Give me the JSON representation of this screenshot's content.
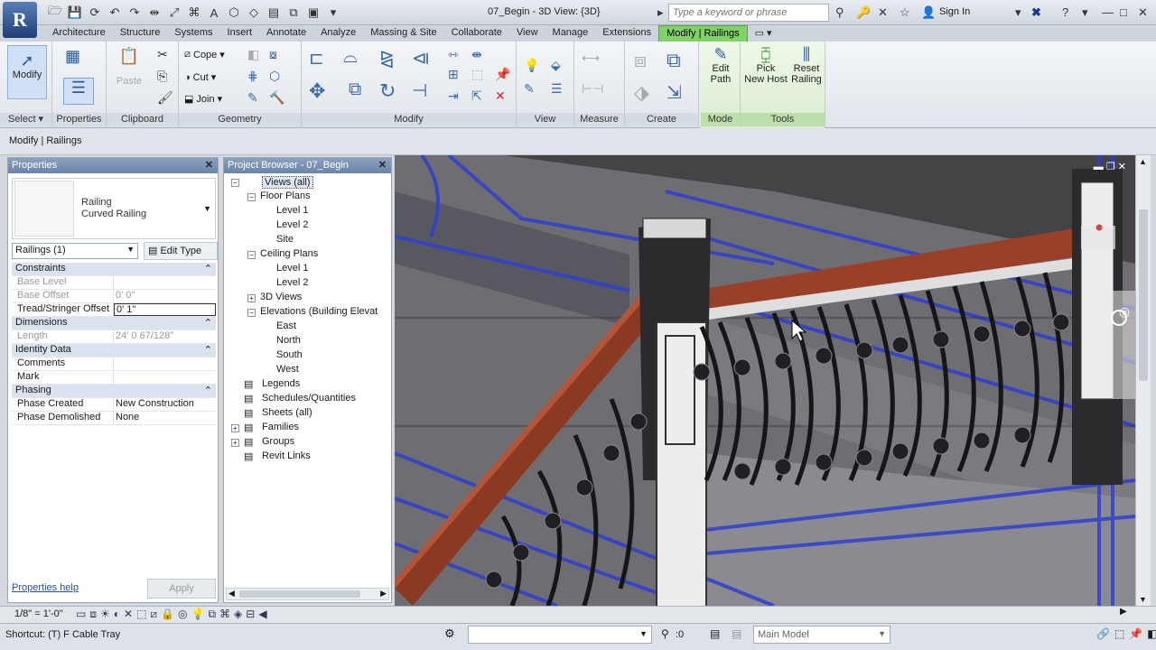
{
  "app": {
    "logo": "R",
    "title": "07_Begin - 3D View: {3D}"
  },
  "search": {
    "placeholder": "Type a keyword or phrase"
  },
  "user": {
    "signin": "Sign In"
  },
  "tabs": [
    "Architecture",
    "Structure",
    "Systems",
    "Insert",
    "Annotate",
    "Analyze",
    "Massing & Site",
    "Collaborate",
    "View",
    "Manage",
    "Extensions",
    "Modify | Railings"
  ],
  "ribbon": {
    "select": {
      "label": "Select",
      "modify": "Modify"
    },
    "properties": {
      "label": "Properties"
    },
    "clipboard": {
      "label": "Clipboard",
      "paste": "Paste"
    },
    "geometry": {
      "label": "Geometry",
      "cope": "Cope",
      "cut": "Cut",
      "join": "Join"
    },
    "modify": {
      "label": "Modify"
    },
    "view": {
      "label": "View"
    },
    "measure": {
      "label": "Measure"
    },
    "create": {
      "label": "Create"
    },
    "mode": {
      "label": "Mode",
      "edit_path": "Edit Path",
      "edit_path_l1": "Edit",
      "edit_path_l2": "Path"
    },
    "tools": {
      "label": "Tools",
      "pick_l1": "Pick",
      "pick_l2": "New Host",
      "reset_l1": "Reset",
      "reset_l2": "Railing"
    }
  },
  "context_bar": {
    "label": "Modify | Railings"
  },
  "properties": {
    "title": "Properties",
    "type_line1": "Railing",
    "type_line2": "Curved Railing",
    "instance_filter": "Railings (1)",
    "edit_type": "Edit Type",
    "rows": [
      {
        "cat": "Constraints"
      },
      {
        "k": "Base Level",
        "v": "",
        "dis": true
      },
      {
        "k": "Base Offset",
        "v": "0'  0\"",
        "dis": true
      },
      {
        "k": "Tread/Stringer Offset",
        "v": "0'  1\"",
        "edit": true
      },
      {
        "cat": "Dimensions"
      },
      {
        "k": "Length",
        "v": "24'  0 67/128\"",
        "dis": true
      },
      {
        "cat": "Identity Data"
      },
      {
        "k": "Comments",
        "v": ""
      },
      {
        "k": "Mark",
        "v": ""
      },
      {
        "cat": "Phasing"
      },
      {
        "k": "Phase Created",
        "v": "New Construction"
      },
      {
        "k": "Phase Demolished",
        "v": "None"
      }
    ],
    "help": "Properties help",
    "apply": "Apply"
  },
  "browser": {
    "title": "Project Browser - 07_Begin",
    "nodes": [
      {
        "t": "Views (all)",
        "lvl": 0,
        "tog": "−",
        "sel": true
      },
      {
        "t": "Floor Plans",
        "lvl": 1,
        "tog": "−"
      },
      {
        "t": "Level 1",
        "lvl": 2
      },
      {
        "t": "Level 2",
        "lvl": 2
      },
      {
        "t": "Site",
        "lvl": 2
      },
      {
        "t": "Ceiling Plans",
        "lvl": 1,
        "tog": "−"
      },
      {
        "t": "Level 1",
        "lvl": 2
      },
      {
        "t": "Level 2",
        "lvl": 2
      },
      {
        "t": "3D Views",
        "lvl": 1,
        "tog": "+"
      },
      {
        "t": "Elevations (Building Elevat",
        "lvl": 1,
        "tog": "−"
      },
      {
        "t": "East",
        "lvl": 2
      },
      {
        "t": "North",
        "lvl": 2
      },
      {
        "t": "South",
        "lvl": 2
      },
      {
        "t": "West",
        "lvl": 2
      },
      {
        "t": "Legends",
        "lvl": 0
      },
      {
        "t": "Schedules/Quantities",
        "lvl": 0
      },
      {
        "t": "Sheets (all)",
        "lvl": 0
      },
      {
        "t": "Families",
        "lvl": 0,
        "tog": "+"
      },
      {
        "t": "Groups",
        "lvl": 0,
        "tog": "+"
      },
      {
        "t": "Revit Links",
        "lvl": 0
      }
    ]
  },
  "viewbar": {
    "scale": "1/8\" = 1'-0\""
  },
  "status": {
    "text": "Shortcut: (T) F Cable Tray",
    "model": "Main Model",
    "count": ":0"
  }
}
